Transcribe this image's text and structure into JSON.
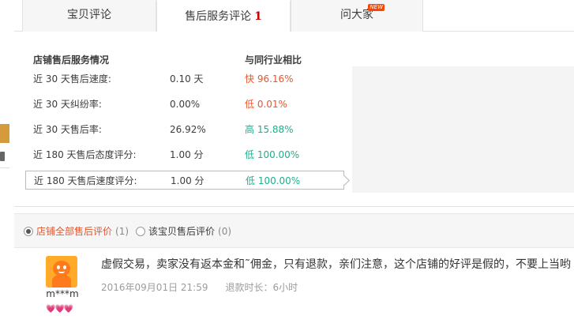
{
  "tabs": [
    {
      "label": "宝贝评论",
      "active": false
    },
    {
      "label": "售后服务评论",
      "count": "1",
      "active": true
    },
    {
      "label": "问大家",
      "badge": "NEW",
      "active": false
    }
  ],
  "stats": {
    "header_left": "店铺售后服务情况",
    "header_right": "与同行业相比",
    "rows": [
      {
        "label": "近 30 天售后速度:",
        "value": "0.10 天",
        "compare": "快 96.16%",
        "tone": "orange"
      },
      {
        "label": "近 30 天纠纷率:",
        "value": "0.00%",
        "compare": "低 0.01%",
        "tone": "orange"
      },
      {
        "label": "近 30 天售后率:",
        "value": "26.92%",
        "compare": "高 15.88%",
        "tone": "green"
      },
      {
        "label": "近 180 天售后态度评分:",
        "value": "1.00 分",
        "compare": "低 100.00%",
        "tone": "green"
      },
      {
        "label": "近 180 天售后速度评分:",
        "value": "1.00 分",
        "compare": "低 100.00%",
        "tone": "green",
        "selected": true
      }
    ]
  },
  "filter": {
    "options": [
      {
        "label": "店铺全部售后评价",
        "count": "(1)",
        "checked": true
      },
      {
        "label": "该宝贝售后评价",
        "count": "(0)",
        "checked": false
      }
    ]
  },
  "review": {
    "nickname": "m***m",
    "text": "虚假交易，卖家没有返本金和˜佣金，只有退款，亲们注意，这个店铺的好评是假的，不要上当哟",
    "date": "2016年09月01日 21:59",
    "refund_time": "退款时长：6小时",
    "hearts": "💗💗💗"
  },
  "colors": {
    "accent": "#e4572d",
    "positive": "#1eaf8c",
    "count_red": "#c40000"
  }
}
